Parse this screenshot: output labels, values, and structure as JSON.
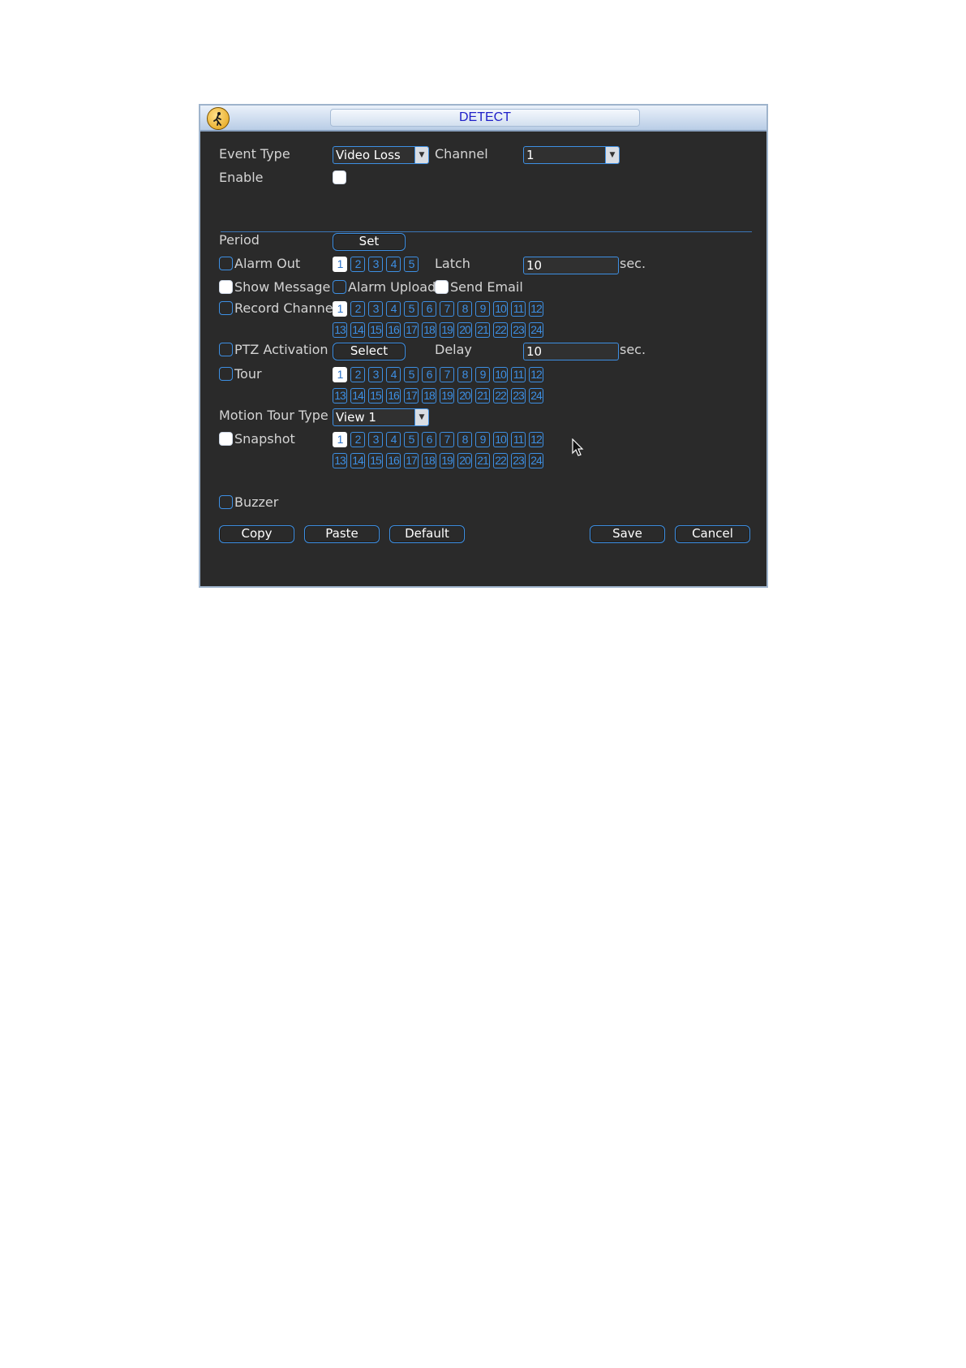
{
  "window": {
    "title": "DETECT"
  },
  "event_type": {
    "label": "Event Type",
    "value": "Video Loss"
  },
  "channel": {
    "label": "Channel",
    "value": "1"
  },
  "enable": {
    "label": "Enable"
  },
  "period": {
    "label": "Period",
    "button": "Set"
  },
  "alarm_out": {
    "label": "Alarm Out",
    "numbers": [
      "1",
      "2",
      "3",
      "4",
      "5"
    ]
  },
  "latch": {
    "label": "Latch",
    "value": "10",
    "unit": "sec."
  },
  "show_message": {
    "label": "Show Message"
  },
  "alarm_upload": {
    "label": "Alarm Upload"
  },
  "send_email": {
    "label": "Send Email"
  },
  "record_channel": {
    "label": "Record Channel"
  },
  "ptz_activation": {
    "label": "PTZ Activation",
    "button": "Select"
  },
  "delay": {
    "label": "Delay",
    "value": "10",
    "unit": "sec."
  },
  "tour": {
    "label": "Tour"
  },
  "motion_tour_type": {
    "label": "Motion Tour Type",
    "value": "View 1"
  },
  "snapshot": {
    "label": "Snapshot"
  },
  "buzzer": {
    "label": "Buzzer"
  },
  "channels_row1": [
    "1",
    "2",
    "3",
    "4",
    "5",
    "6",
    "7",
    "8",
    "9",
    "10",
    "11",
    "12"
  ],
  "channels_row2": [
    "13",
    "14",
    "15",
    "16",
    "17",
    "18",
    "19",
    "20",
    "21",
    "22",
    "23",
    "24"
  ],
  "buttons": {
    "copy": "Copy",
    "paste": "Paste",
    "default": "Default",
    "save": "Save",
    "cancel": "Cancel"
  },
  "colors": {
    "accent": "#3d8fe3",
    "panel": "#2a2a2a",
    "title_text": "#2020c8"
  },
  "icons": {
    "title": "pedestrian-icon",
    "dropdown": "triangle-down-icon",
    "cursor": "mouse-pointer-icon"
  }
}
